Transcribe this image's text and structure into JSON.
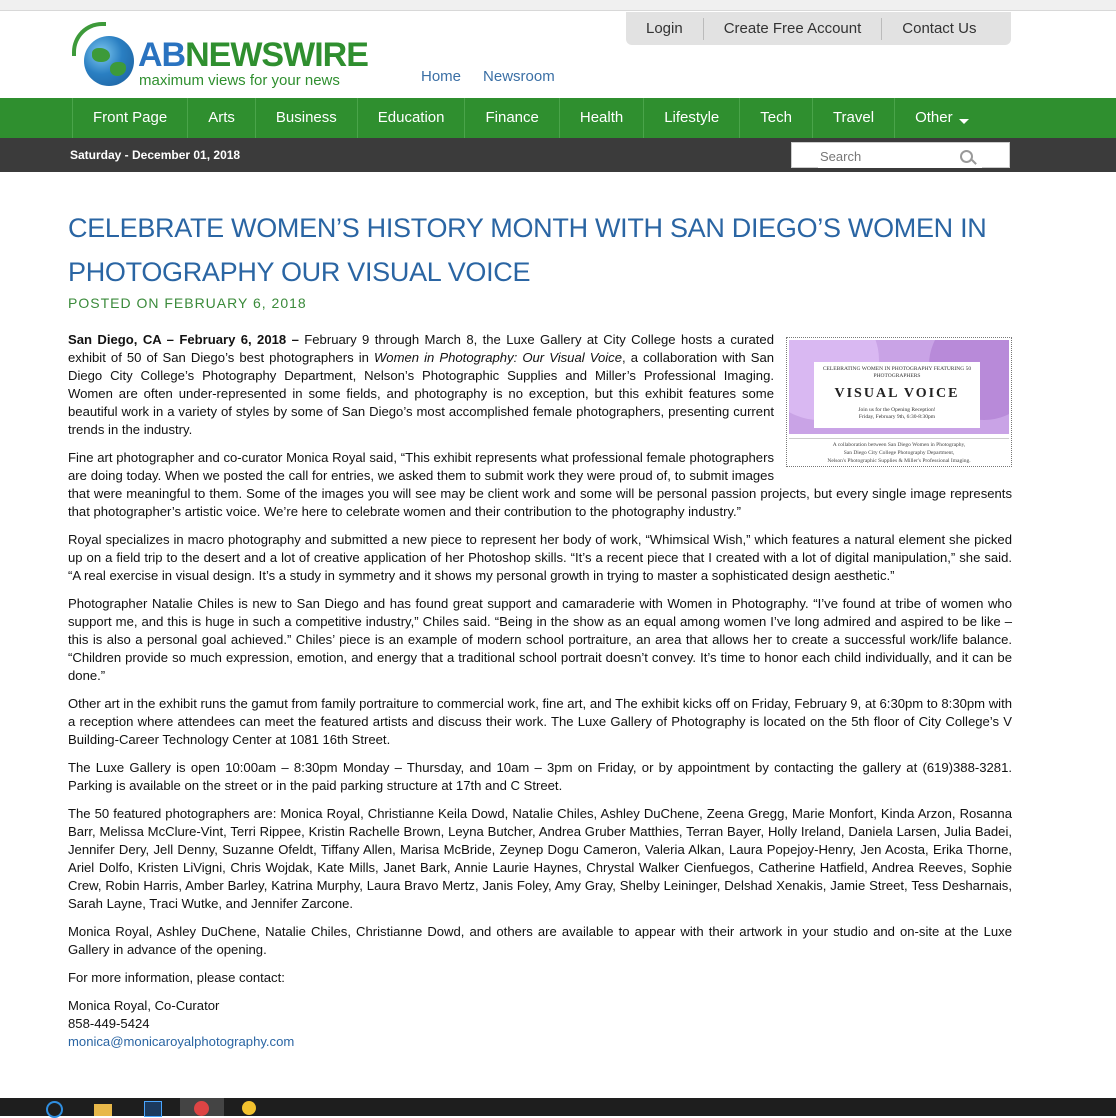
{
  "logo": {
    "name_part1": "AB",
    "name_part2": "NEWSWIRE",
    "tagline": "maximum views for your news"
  },
  "account_links": [
    "Login",
    "Create Free Account",
    "Contact Us"
  ],
  "subnav": [
    "Home",
    "Newsroom"
  ],
  "menu": [
    "Front Page",
    "Arts",
    "Business",
    "Education",
    "Finance",
    "Health",
    "Lifestyle",
    "Tech",
    "Travel",
    "Other"
  ],
  "date": "Saturday - December 01, 2018",
  "search": {
    "placeholder": "Search"
  },
  "article": {
    "title": "CELEBRATE WOMEN’S HISTORY MONTH WITH SAN DIEGO’S WOMEN IN PHOTOGRAPHY OUR VISUAL VOICE",
    "posted": "POSTED ON FEBRUARY 6, 2018",
    "lead_dateline": "San Diego, CA – February 6, 2018 –",
    "p1_a": " February 9 through March 8, the Luxe Gallery at City College hosts a curated exhibit of 50 of San Diego’s best photographers in ",
    "p1_em": "Women in Photography: Our Visual Voice",
    "p1_b": ", a collaboration with San Diego City College’s Photography Department, Nelson’s Photographic Supplies and Miller’s Professional Imaging. Women are often under-represented in some fields, and photography is no exception, but this exhibit features some beautiful work in a variety of styles by some of San Diego’s most accomplished female photographers, presenting current trends in the industry.",
    "p2": "Fine art photographer and co-curator Monica Royal said, “This exhibit represents what professional female photographers are doing today. When we posted the call for entries, we asked them to submit work they were proud of, to submit images that were meaningful to them. Some of the images you will see may be client work and some will be personal passion projects, but every single image represents that photographer’s artistic voice. We’re here to celebrate women and their contribution to the photography industry.”",
    "p3": "Royal specializes in macro photography and submitted a new piece to represent her body of work, “Whimsical Wish,” which features a natural element she picked up on a field trip to the desert and a lot of creative application of her Photoshop skills. “It’s a recent piece that I created with a lot of digital manipulation,” she said. “A real exercise in visual design. It’s a study in symmetry and it shows my personal growth in trying to master a sophisticated design aesthetic.”",
    "p4": "Photographer Natalie Chiles is new to San Diego and has found great support and camaraderie with Women in Photography. “I’ve found at tribe of women who support me, and this is huge in such a competitive industry,” Chiles said. “Being in the show as an equal among women I’ve long admired and aspired to be like – this is also a personal goal achieved.” Chiles’ piece is an example of modern school portraiture, an area that allows her to create a successful work/life balance. “Children provide so much expression, emotion, and energy that a traditional school portrait doesn’t convey. It’s time to honor each child individually, and it can be done.”",
    "p5": "Other art in the exhibit runs the gamut from family portraiture to commercial work, fine art, and The exhibit kicks off on Friday, February 9, at 6:30pm to 8:30pm with a reception where attendees can meet the featured artists and discuss their work. The Luxe Gallery of Photography is located on the 5th floor of City College’s V Building-Career Technology Center at 1081 16th Street.",
    "p6": "The Luxe Gallery is open 10:00am – 8:30pm Monday – Thursday, and 10am – 3pm on Friday, or by appointment by contacting the gallery at (619)388-3281. Parking is available on the street or in the paid parking structure at 17th and C Street.",
    "p7": "The 50 featured photographers are: Monica Royal, Christianne Keila Dowd, Natalie Chiles, Ashley DuChene, Zeena Gregg, Marie Monfort, Kinda Arzon, Rosanna Barr, Melissa McClure-Vint, Terri Rippee, Kristin Rachelle Brown, Leyna Butcher, Andrea Gruber Matthies, Terran Bayer, Holly Ireland, Daniela Larsen, Julia Badei, Jennifer Dery, Jell Denny, Suzanne Ofeldt, Tiffany Allen, Marisa McBride, Zeynep Dogu Cameron, Valeria Alkan, Laura Popejoy-Henry, Jen Acosta, Erika Thorne, Ariel Dolfo, Kristen LiVigni, Chris Wojdak, Kate Mills, Janet Bark, Annie Laurie Haynes, Chrystal Walker Cienfuegos, Catherine Hatfield, Andrea Reeves, Sophie Crew, Robin Harris, Amber Barley, Katrina Murphy, Laura Bravo Mertz, Janis Foley, Amy Gray, Shelby Leininger, Delshad Xenakis, Jamie Street, Tess Desharnais, Sarah Layne, Traci Wutke, and Jennifer Zarcone.",
    "p8": "Monica Royal, Ashley DuChene, Natalie Chiles, Christianne Dowd, and others are available to appear with their artwork in your studio and on-site at the Luxe Gallery in advance of the opening.",
    "p9": "For more information, please contact:",
    "contact_name": "Monica Royal, Co-Curator",
    "contact_phone": "858-449-5424",
    "contact_email": "monica@monicaroyalphotography.com"
  },
  "flyer": {
    "top": "CELEBRATING WOMEN IN PHOTOGRAPHY FEATURING 50 PHOTOGRAPHERS",
    "headline": "VISUAL VOICE",
    "line1": "Join us for the Opening Reception!",
    "line2": "Friday, February 9th, 6:30-8:30pm",
    "foot1": "A collaboration between San Diego Women in Photography,",
    "foot2": "San Diego City College Photography Department,",
    "foot3": "Nelson's Photographic Supplies & Miller's Professional Imaging."
  }
}
